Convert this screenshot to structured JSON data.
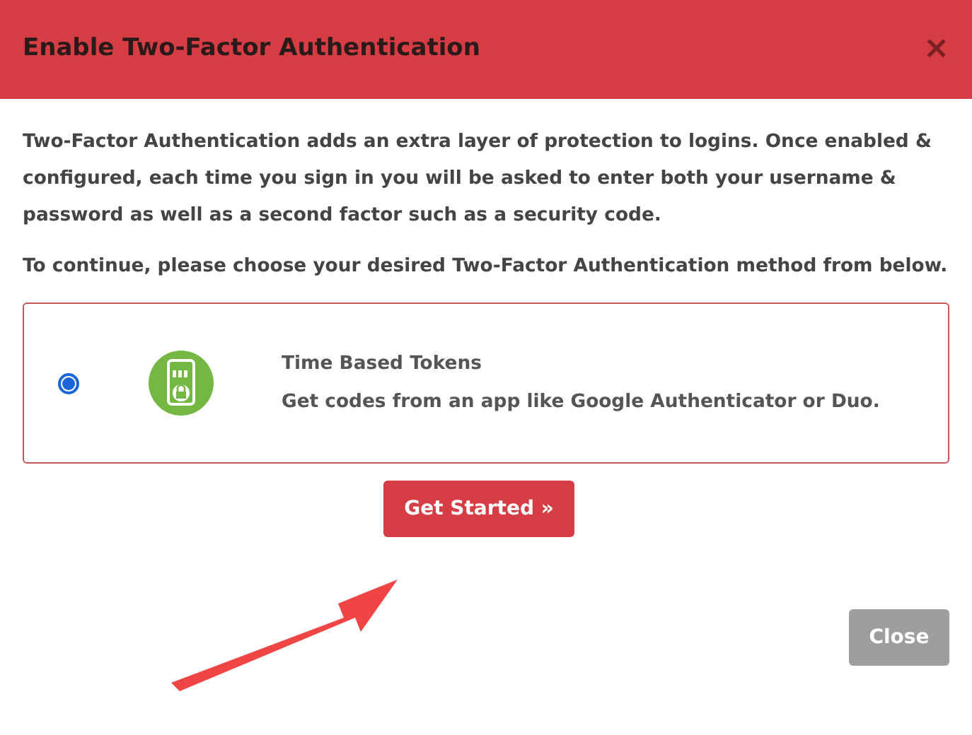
{
  "dialog": {
    "title": "Enable Two-Factor Authentication",
    "close_icon": "×"
  },
  "paragraphs": [
    "Two-Factor Authentication adds an extra layer of protection to logins. Once enabled & configured, each time you sign in you will be asked to enter both your username & password as well as a second factor such as a security code.",
    "To continue, please choose your desired Two-Factor Authentication method from below."
  ],
  "methods": [
    {
      "title": "Time Based Tokens",
      "description": "Get codes from an app like Google Authenticator or Duo.",
      "selected": true
    }
  ],
  "primary_button": "Get Started »",
  "footer_button": "Close"
}
